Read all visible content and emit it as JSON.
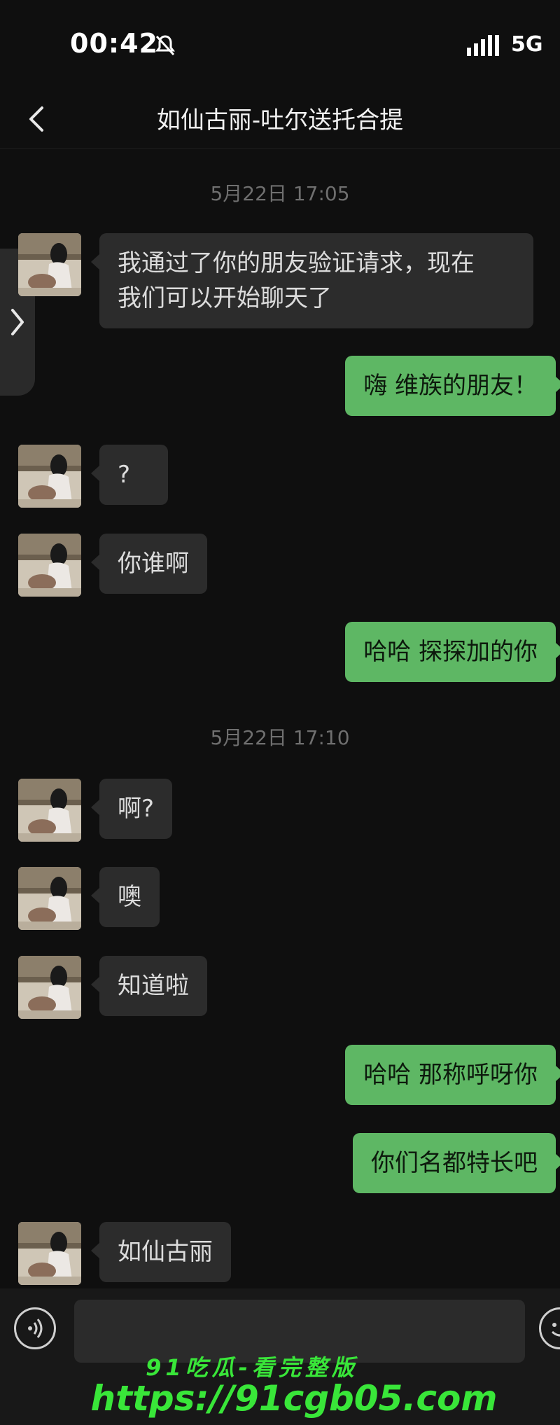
{
  "status_bar": {
    "time": "00:42",
    "network": "5G"
  },
  "header": {
    "title": "如仙古丽-吐尔送托合提"
  },
  "timestamps": [
    "5月22日 17:05",
    "5月22日 17:10"
  ],
  "messages": [
    {
      "side": "in",
      "lines": [
        "我通过了你的朋友验证请求，现在",
        "我们可以开始聊天了"
      ]
    },
    {
      "side": "out",
      "text": "嗨 维族的朋友！"
    },
    {
      "side": "in",
      "text": "?"
    },
    {
      "side": "in",
      "text": "你谁啊"
    },
    {
      "side": "out",
      "text": "哈哈 探探加的你"
    },
    {
      "side": "in",
      "text": "啊?"
    },
    {
      "side": "in",
      "text": "噢"
    },
    {
      "side": "in",
      "text": "知道啦"
    },
    {
      "side": "out",
      "text": "哈哈 那称呼呀你"
    },
    {
      "side": "out",
      "text": "你们名都特长吧"
    },
    {
      "side": "in",
      "text": "如仙古丽"
    }
  ],
  "watermark": {
    "line1": "91吃瓜-看完整版",
    "line2": "https://91cgb05.com"
  },
  "colors": {
    "background": "#0f0f0f",
    "bubble_in": "#2c2c2c",
    "bubble_out": "#5eb764",
    "watermark": "#39e639"
  },
  "icons": [
    "mute-icon",
    "signal-icon",
    "back-arrow-icon",
    "chevron-right-icon",
    "voice-icon",
    "emoji-icon"
  ]
}
